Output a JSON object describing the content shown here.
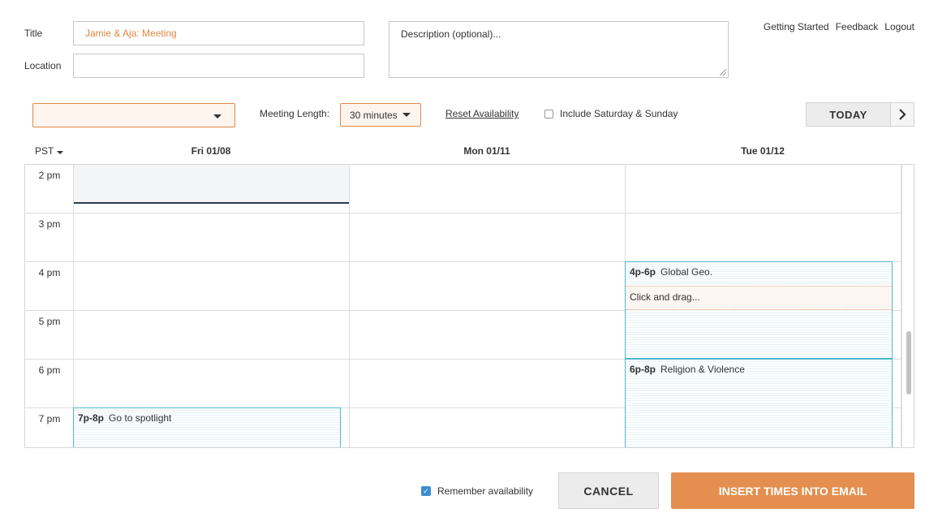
{
  "form": {
    "title_label": "Title",
    "title_value": "Jamie & Aja: Meeting",
    "location_label": "Location",
    "location_value": "",
    "description_placeholder": "Description (optional)..."
  },
  "top_links": [
    "Getting Started",
    "Feedback",
    "Logout"
  ],
  "toolbar": {
    "calendar_select_value": "",
    "meeting_length_label": "Meeting Length:",
    "meeting_length_value": "30 minutes",
    "reset_label": "Reset Availability",
    "weekend_label": "Include Saturday & Sunday",
    "weekend_checked": false,
    "today_label": "TODAY"
  },
  "calendar": {
    "timezone": "PST",
    "days": [
      "Fri 01/08",
      "Mon 01/11",
      "Tue 01/12"
    ],
    "hours": [
      "2 pm",
      "3 pm",
      "4 pm",
      "5 pm",
      "6 pm",
      "7 pm"
    ],
    "events": [
      {
        "day": "Tue 01/12",
        "time": "4p-6p",
        "title": "Global Geo.",
        "hint": "Click and drag..."
      },
      {
        "day": "Tue 01/12",
        "time": "6p-8p",
        "title": "Religion & Violence"
      },
      {
        "day": "Fri 01/08",
        "time": "7p-8p",
        "title": "Go to spotlight"
      }
    ]
  },
  "footer": {
    "remember_label": "Remember availability",
    "remember_checked": true,
    "cancel_label": "CANCEL",
    "insert_label": "INSERT TIMES INTO EMAIL"
  },
  "colors": {
    "accent": "#e48f4f",
    "accent_light": "#fef5ee",
    "event_border": "#4eb7cf",
    "selection_line": "#2a3a55",
    "checkbox_blue": "#3f8cd6"
  }
}
